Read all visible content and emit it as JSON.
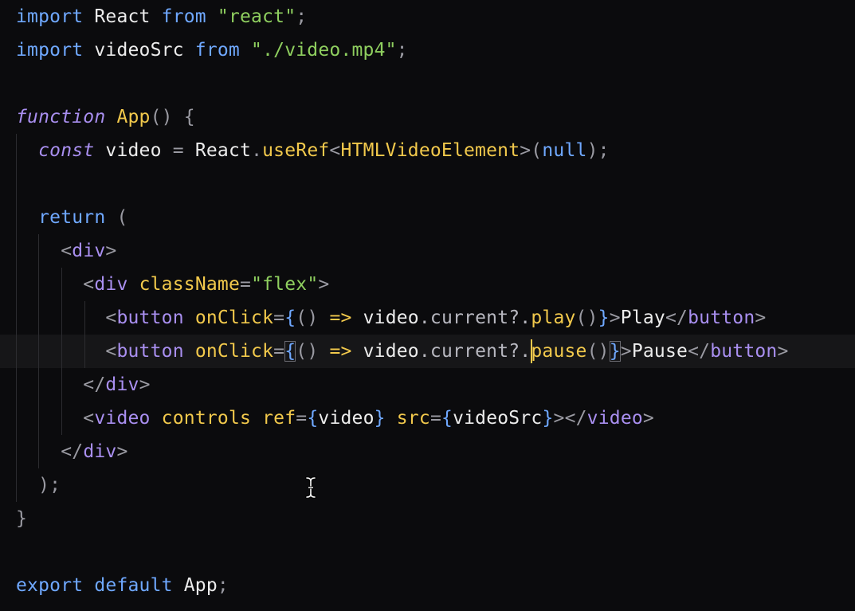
{
  "editor": {
    "language": "tsx",
    "theme_colors": {
      "background": "#0b0b0d",
      "keyword": "#6fa8ff",
      "storage_italic": "#a98ff0",
      "string": "#8fcf5f",
      "function": "#f2c94c",
      "tag": "#a98ff0",
      "punctuation": "#9a9aa2",
      "current_line": "#161618",
      "caret": "#f2c94c"
    },
    "cursor_icon": "text-ibeam-icon",
    "lines": [
      {
        "t1": "import",
        "t2": " React ",
        "t3": "from",
        "t4": " ",
        "t5": "\"react\"",
        "t6": ";"
      },
      {
        "t1": "import",
        "t2": " videoSrc ",
        "t3": "from",
        "t4": " ",
        "t5": "\"./video.mp4\"",
        "t6": ";"
      },
      {},
      {
        "t1": "function",
        "t2": " ",
        "t3": "App",
        "t4": "()",
        "t5": " ",
        "t6": "{"
      },
      {
        "t1": "const",
        "t2": " video ",
        "t3": "=",
        "t4": " React",
        "t5": ".",
        "t6": "useRef",
        "t7": "<",
        "t8": "HTMLVideoElement",
        "t9": ">(",
        "t10": "null",
        "t11": ");"
      },
      {},
      {
        "t1": "return",
        "t2": " ("
      },
      {
        "t1": "<",
        "t2": "div",
        "t3": ">"
      },
      {
        "t1": "<",
        "t2": "div",
        "t3": " ",
        "t4": "className",
        "t5": "=",
        "t6": "\"flex\"",
        "t7": ">"
      },
      {
        "t1": "<",
        "t2": "button",
        "t3": " ",
        "t4": "onClick",
        "t5": "=",
        "t6": "{",
        "t7": "()",
        "t8": " ",
        "t9": "=>",
        "t10": " video",
        "t11": ".current?.",
        "t12": "play",
        "t13": "()",
        "t14": "}",
        "t15": ">",
        "t16": "Play",
        "t17": "</",
        "t18": "button",
        "t19": ">"
      },
      {
        "t1": "<",
        "t2": "button",
        "t3": " ",
        "t4": "onClick",
        "t5": "=",
        "t6": "{",
        "t7": "()",
        "t8": " ",
        "t9": "=>",
        "t10": " video",
        "t11": ".current?.",
        "t12": "pause",
        "t13": "()",
        "t14": "}",
        "t15": ">",
        "t16": "Pause",
        "t17": "</",
        "t18": "button",
        "t19": ">"
      },
      {
        "t1": "</",
        "t2": "div",
        "t3": ">"
      },
      {
        "t1": "<",
        "t2": "video",
        "t3": " ",
        "t4": "controls",
        "t5": " ",
        "t6": "ref",
        "t7": "=",
        "t8": "{",
        "t9": "video",
        "t10": "}",
        "t11": " ",
        "t12": "src",
        "t13": "=",
        "t14": "{",
        "t15": "videoSrc",
        "t16": "}",
        "t17": "></",
        "t18": "video",
        "t19": ">"
      },
      {
        "t1": "</",
        "t2": "div",
        "t3": ">"
      },
      {
        "t1": ");"
      },
      {
        "t1": "}"
      },
      {},
      {
        "t1": "export",
        "t2": " ",
        "t3": "default",
        "t4": " App",
        "t5": ";"
      }
    ]
  }
}
